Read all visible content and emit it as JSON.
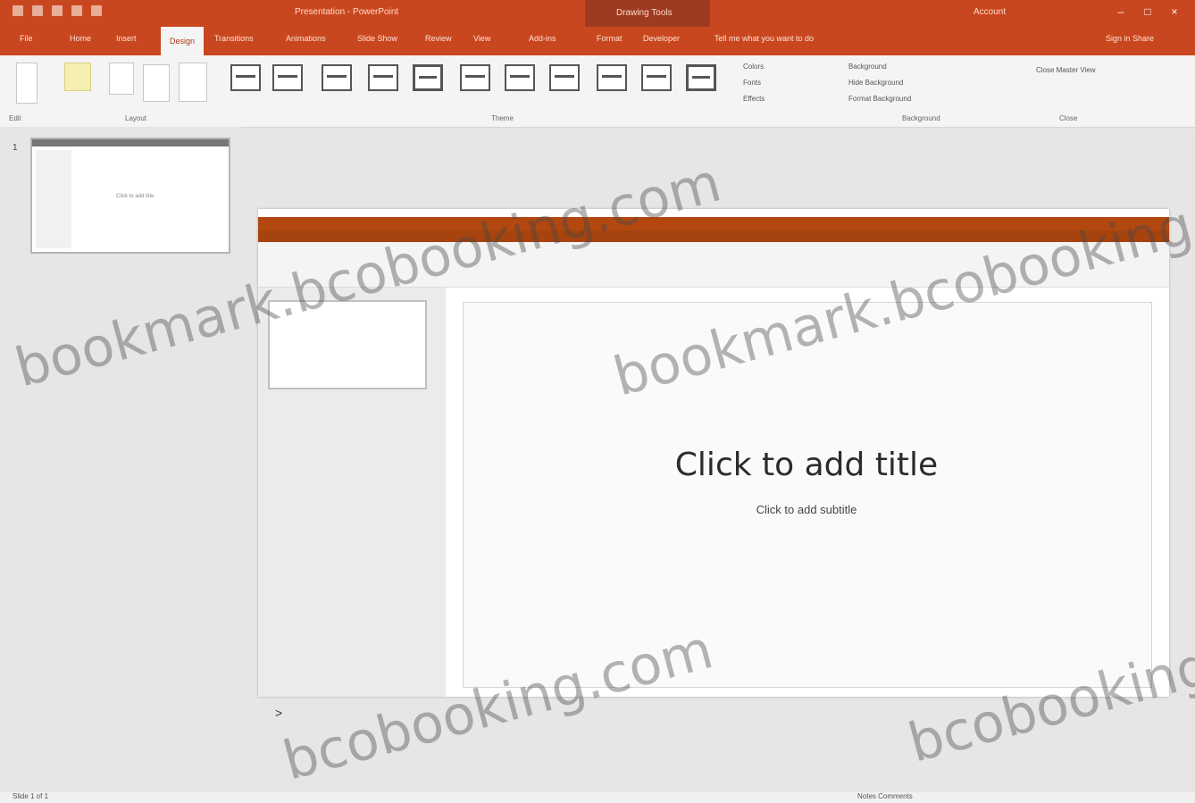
{
  "app": {
    "window_title": "Presentation - PowerPoint",
    "contextual_group": "Drawing Tools",
    "user": "Account"
  },
  "tabs": [
    "File",
    "Home",
    "Insert",
    "Design",
    "Transitions",
    "Animations",
    "Slide Show",
    "Review",
    "View",
    "Add-ins",
    "Format",
    "Developer"
  ],
  "active_tab": "Design",
  "tell_me": "Tell me what you want to do",
  "sign_in": "Sign in  Share",
  "ribbon": {
    "groups": [
      "Edit",
      "Layout",
      "Theme",
      "Background",
      "Close"
    ],
    "small_buttons": [
      "Background",
      "Hide Background",
      "Format Background",
      "Colors",
      "Fonts",
      "Effects",
      "Close Master View"
    ]
  },
  "thumbnails": [
    {
      "num": "1",
      "title": "Click to add title"
    }
  ],
  "slide": {
    "title": "Click to add title",
    "subtitle": "Click to add subtitle"
  },
  "status": {
    "left": "Slide 1 of 1",
    "right": "Notes  Comments"
  },
  "notes_toggle": ">",
  "watermarks": [
    "bookmark.bcobooking.com",
    "bookmark.bcobooking.com",
    "bcobooking.com",
    "bcobooking.com"
  ]
}
